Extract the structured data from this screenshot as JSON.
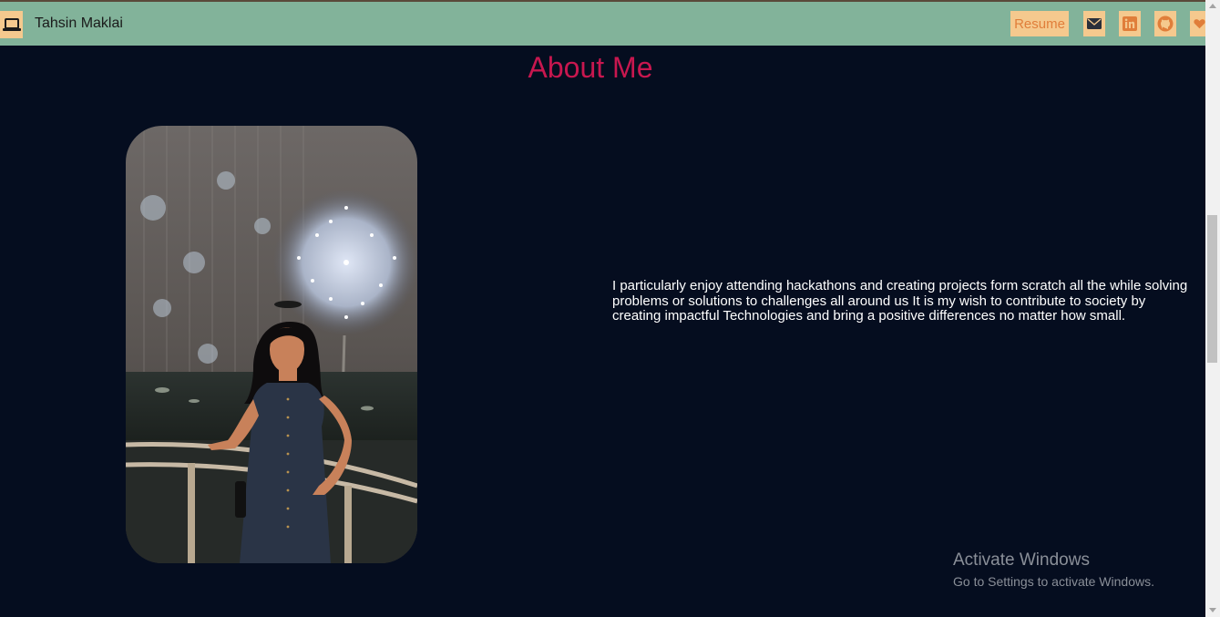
{
  "navbar": {
    "brand_icon": "laptop-icon",
    "brand_name": "Tahsin Maklai",
    "resume_label": "Resume",
    "icons": [
      "envelope-icon",
      "linkedin-icon",
      "github-icon",
      "heart-icon"
    ],
    "background": "#82b39a",
    "button_color": "#f5c98e",
    "icon_color": "#e07e3a"
  },
  "about": {
    "title": "About Me",
    "title_color": "#c8174f",
    "text": "I particularly enjoy attending hackathons and creating projects form scratch all the while solving problems or solutions to challenges all around us It is my wish to contribute to society by creating impactful Technologies and bring a positive differences no matter how small."
  },
  "watermark": {
    "title": "Activate Windows",
    "subtitle": "Go to Settings to activate Windows."
  },
  "page_background": "#050d1f"
}
